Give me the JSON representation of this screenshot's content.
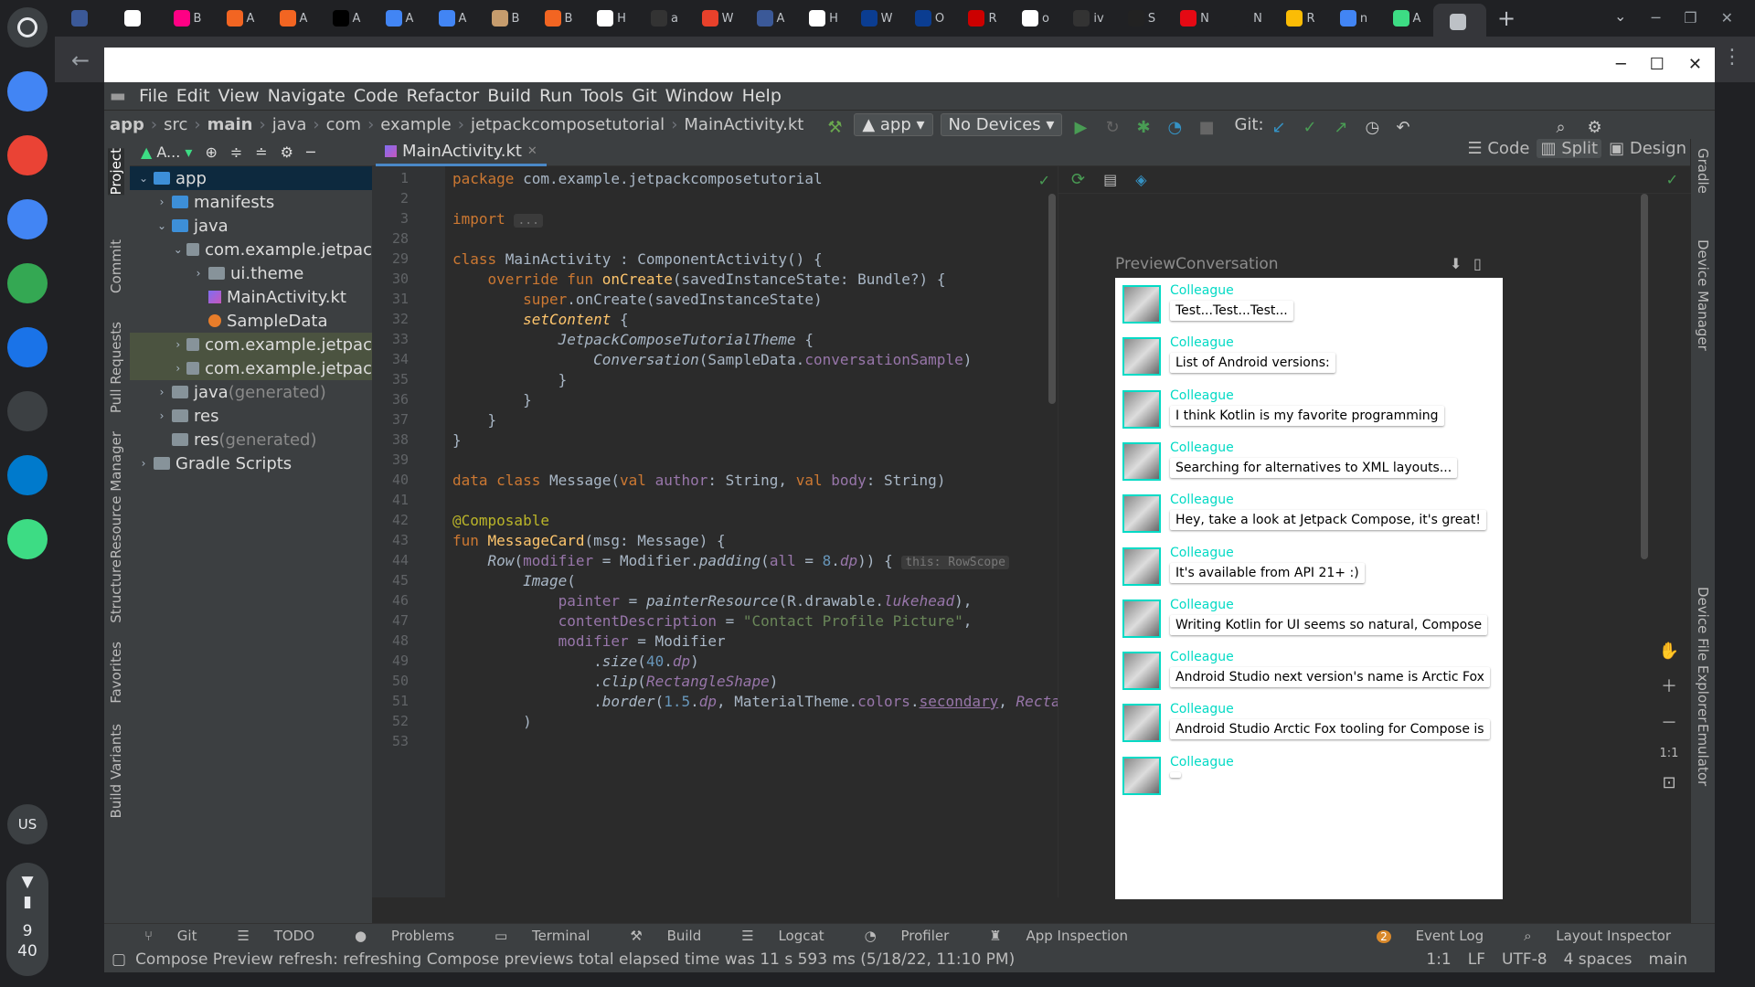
{
  "shelf": {
    "apps": [
      {
        "name": "chrome-icon",
        "color": "#4285f4"
      },
      {
        "name": "gmail-icon",
        "color": "#ea4335"
      },
      {
        "name": "docs-icon",
        "color": "#4285f4"
      },
      {
        "name": "play-store-icon",
        "color": "#34a853"
      },
      {
        "name": "files-icon",
        "color": "#1a73e8"
      },
      {
        "name": "terminal-icon",
        "color": "#3c4043"
      },
      {
        "name": "vscode-icon",
        "color": "#007acc"
      },
      {
        "name": "android-studio-icon",
        "color": "#3ddc84"
      }
    ],
    "ime": "US",
    "clock_hour": "9",
    "clock_min": "40"
  },
  "browser_tabs": [
    {
      "label": "",
      "color": "#3b5998"
    },
    {
      "label": "",
      "color": "#ffffff"
    },
    {
      "label": "B",
      "color": "#ff0084"
    },
    {
      "label": "A",
      "color": "#f26522"
    },
    {
      "label": "A",
      "color": "#f26522"
    },
    {
      "label": "A",
      "color": "#000000"
    },
    {
      "label": "A",
      "color": "#4285f4"
    },
    {
      "label": "A",
      "color": "#4285f4"
    },
    {
      "label": "B",
      "color": "#c69c6d"
    },
    {
      "label": "B",
      "color": "#f26522"
    },
    {
      "label": "H",
      "color": "#ffffff"
    },
    {
      "label": "a",
      "color": "#333333"
    },
    {
      "label": "W",
      "color": "#e8412b"
    },
    {
      "label": "A",
      "color": "#3b5998"
    },
    {
      "label": "H",
      "color": "#ffffff"
    },
    {
      "label": "W",
      "color": "#0b3d91"
    },
    {
      "label": "O",
      "color": "#0b3d91"
    },
    {
      "label": "R",
      "color": "#cc0000"
    },
    {
      "label": "o",
      "color": "#ffffff"
    },
    {
      "label": "iv",
      "color": "#333333"
    },
    {
      "label": "S",
      "color": "#222222"
    },
    {
      "label": "N",
      "color": "#e50914"
    },
    {
      "label": "N",
      "color": "#202124"
    },
    {
      "label": "R",
      "color": "#fbbc05"
    },
    {
      "label": "n",
      "color": "#4285f4"
    },
    {
      "label": "A",
      "color": "#3ddc84"
    },
    {
      "label": "",
      "color": "#bdc1c6"
    }
  ],
  "ide": {
    "menu": [
      "File",
      "Edit",
      "View",
      "Navigate",
      "Code",
      "Refactor",
      "Build",
      "Run",
      "Tools",
      "Git",
      "Window",
      "Help"
    ],
    "breadcrumb": [
      "app",
      "src",
      "main",
      "java",
      "com",
      "example",
      "jetpackcomposetutorial",
      "MainActivity.kt"
    ],
    "run_config": "app",
    "device": "No Devices",
    "git_label": "Git:",
    "project_panel_label": "A...",
    "tree": [
      {
        "label": "app",
        "indent": 0,
        "arrow": "⌄",
        "style": "sel",
        "icon": "fold blue"
      },
      {
        "label": "manifests",
        "indent": 1,
        "arrow": "›",
        "style": "",
        "icon": "fold blue"
      },
      {
        "label": "java",
        "indent": 1,
        "arrow": "⌄",
        "style": "",
        "icon": "fold blue"
      },
      {
        "label": "com.example.jetpac",
        "indent": 2,
        "arrow": "⌄",
        "style": "",
        "icon": "fold"
      },
      {
        "label": "ui.theme",
        "indent": 3,
        "arrow": "›",
        "style": "",
        "icon": "fold"
      },
      {
        "label": "MainActivity.kt",
        "indent": 3,
        "arrow": "",
        "style": "",
        "icon": "kt"
      },
      {
        "label": "SampleData",
        "indent": 3,
        "arrow": "",
        "style": "",
        "icon": "kto"
      },
      {
        "label": "com.example.jetpac",
        "indent": 2,
        "arrow": "›",
        "style": "hl",
        "icon": "fold"
      },
      {
        "label": "com.example.jetpac",
        "indent": 2,
        "arrow": "›",
        "style": "hl",
        "icon": "fold"
      },
      {
        "label": "java",
        "suffix": " (generated)",
        "indent": 1,
        "arrow": "›",
        "style": "",
        "icon": "fold"
      },
      {
        "label": "res",
        "indent": 1,
        "arrow": "›",
        "style": "",
        "icon": "fold"
      },
      {
        "label": "res",
        "suffix": " (generated)",
        "indent": 1,
        "arrow": "",
        "style": "",
        "icon": "fold"
      },
      {
        "label": "Gradle Scripts",
        "indent": 0,
        "arrow": "›",
        "style": "",
        "icon": "fold"
      }
    ],
    "left_tools": [
      "Project",
      "Commit",
      "Pull Requests",
      "Resource Manager",
      "Structure",
      "Favorites",
      "Build Variants"
    ],
    "right_tools": [
      "Gradle",
      "Device Manager",
      "Device File Explorer",
      "Emulator"
    ],
    "editor_tab": "MainActivity.kt",
    "line_numbers": [
      "1",
      "2",
      "3",
      "28",
      "29",
      "30",
      "31",
      "32",
      "33",
      "34",
      "35",
      "36",
      "37",
      "38",
      "39",
      "40",
      "41",
      "42",
      "43",
      "44",
      "45",
      "46",
      "47",
      "48",
      "49",
      "50",
      "51",
      "52",
      "53"
    ],
    "preview_modes": {
      "code": "Code",
      "split": "Split",
      "design": "Design"
    },
    "preview_title": "PreviewConversation",
    "messages": [
      {
        "author": "Colleague",
        "body": "Test...Test...Test..."
      },
      {
        "author": "Colleague",
        "body": "List of Android versions:"
      },
      {
        "author": "Colleague",
        "body": "I think Kotlin is my favorite programming"
      },
      {
        "author": "Colleague",
        "body": "Searching for alternatives to XML layouts..."
      },
      {
        "author": "Colleague",
        "body": "Hey, take a look at Jetpack Compose, it's great!"
      },
      {
        "author": "Colleague",
        "body": "It's available from API 21+ :)"
      },
      {
        "author": "Colleague",
        "body": "Writing Kotlin for UI seems so natural, Compose"
      },
      {
        "author": "Colleague",
        "body": "Android Studio next version's name is Arctic Fox"
      },
      {
        "author": "Colleague",
        "body": "Android Studio Arctic Fox tooling for Compose is"
      },
      {
        "author": "Colleague",
        "body": ""
      }
    ],
    "zoom_reset": "1:1",
    "bottom_tools": [
      "Git",
      "TODO",
      "Problems",
      "Terminal",
      "Build",
      "Logcat",
      "Profiler",
      "App Inspection"
    ],
    "bottom_right": {
      "event_log_count": "2",
      "event_log": "Event Log",
      "layout_inspector": "Layout Inspector"
    },
    "status_message": "Compose Preview refresh: refreshing Compose previews total elapsed time was 11 s 593 ms (5/18/22, 11:10 PM)",
    "status_right": [
      "1:1",
      "LF",
      "UTF-8",
      "4 spaces",
      "main"
    ]
  },
  "code_text": {
    "l1a": "package ",
    "l1b": "com.example.jetpackcomposetutorial",
    "l3a": "import ",
    "l3b": "...",
    "l29a": "class ",
    "l29b": "MainActivity : ComponentActivity() {",
    "l30a": "    override fun ",
    "l30b": "onCreate",
    "l30c": "(savedInstanceState: Bundle?) {",
    "l31a": "        super",
    "l31b": ".onCreate(savedInstanceState)",
    "l32a": "        setContent",
    "l32b": " {",
    "l33a": "            JetpackComposeTutorialTheme",
    "l33b": " {",
    "l34a": "                Conversation",
    "l34b": "(SampleData.",
    "l34c": "conversationSample",
    "l34d": ")",
    "l35": "            }",
    "l36": "        }",
    "l37": "    }",
    "l38": "}",
    "l40a": "data class ",
    "l40b": "Message(",
    "l40c": "val ",
    "l40d": "author",
    "l40e": ": String, ",
    "l40f": "val ",
    "l40g": "body",
    "l40h": ": String)",
    "l42": "@Composable",
    "l43a": "fun ",
    "l43b": "MessageCard",
    "l43c": "(msg: Message) {",
    "l44a": "    Row",
    "l44b": "(",
    "l44c": "modifier",
    "l44d": " = Modifier.",
    "l44e": "padding",
    "l44f": "(",
    "l44g": "all",
    "l44h": " = ",
    "l44i": "8",
    "l44j": ".",
    "l44k": "dp",
    "l44l": ")) {",
    "l44hint": "this: RowScope",
    "l45a": "        Image",
    "l45b": "(",
    "l46a": "            painter",
    "l46b": " = ",
    "l46c": "painterResource",
    "l46d": "(R.drawable.",
    "l46e": "lukehead",
    "l46f": "),",
    "l47a": "            contentDescription",
    "l47b": " = ",
    "l47c": "\"Contact Profile Picture\"",
    "l47d": ",",
    "l48a": "            modifier",
    "l48b": " = Modifier",
    "l49a": "                .",
    "l49b": "size",
    "l49c": "(",
    "l49d": "40",
    "l49e": ".",
    "l49f": "dp",
    "l49g": ")",
    "l50a": "                .",
    "l50b": "clip",
    "l50c": "(",
    "l50d": "RectangleShape",
    "l50e": ")",
    "l51a": "                .",
    "l51b": "border",
    "l51c": "(",
    "l51d": "1.5",
    "l51e": ".",
    "l51f": "dp",
    "l51g": ", MaterialTheme.",
    "l51h": "colors",
    "l51i": ".",
    "l51j": "secondary",
    "l51k": ", ",
    "l51l": "RectangleShape",
    "l51m": ")",
    "l52": "        )"
  }
}
